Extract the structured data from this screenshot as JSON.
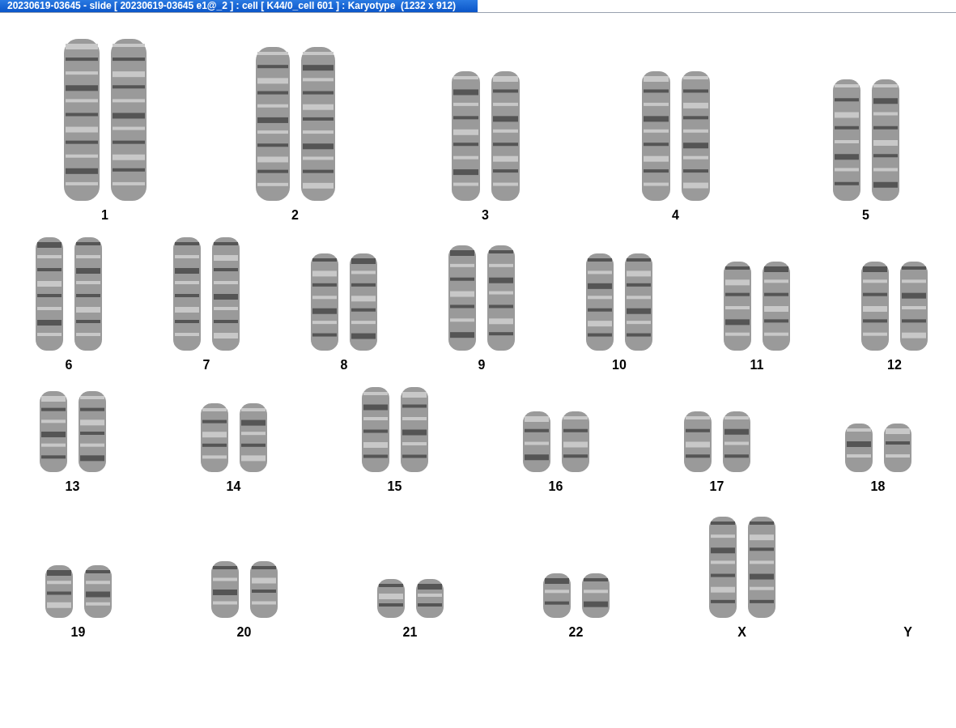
{
  "window": {
    "title": "20230619-03645 - slide [ 20230619-03645 e1@_2 ] : cell [ K44/0_cell 601 ] : Karyotype  (1232 x 912)"
  },
  "karyotype_rows": [
    {
      "pairs": [
        {
          "label": "1"
        },
        {
          "label": "2"
        },
        {
          "label": "3"
        },
        {
          "label": "4"
        },
        {
          "label": "5"
        }
      ]
    },
    {
      "pairs": [
        {
          "label": "6"
        },
        {
          "label": "7"
        },
        {
          "label": "8"
        },
        {
          "label": "9"
        },
        {
          "label": "10"
        },
        {
          "label": "11"
        },
        {
          "label": "12"
        }
      ]
    },
    {
      "pairs": [
        {
          "label": "13"
        },
        {
          "label": "14"
        },
        {
          "label": "15"
        },
        {
          "label": "16"
        },
        {
          "label": "17"
        },
        {
          "label": "18"
        }
      ]
    },
    {
      "pairs": [
        {
          "label": "19"
        },
        {
          "label": "20"
        },
        {
          "label": "21"
        },
        {
          "label": "22"
        },
        {
          "label": "X"
        },
        {
          "label": "Y"
        }
      ]
    }
  ]
}
